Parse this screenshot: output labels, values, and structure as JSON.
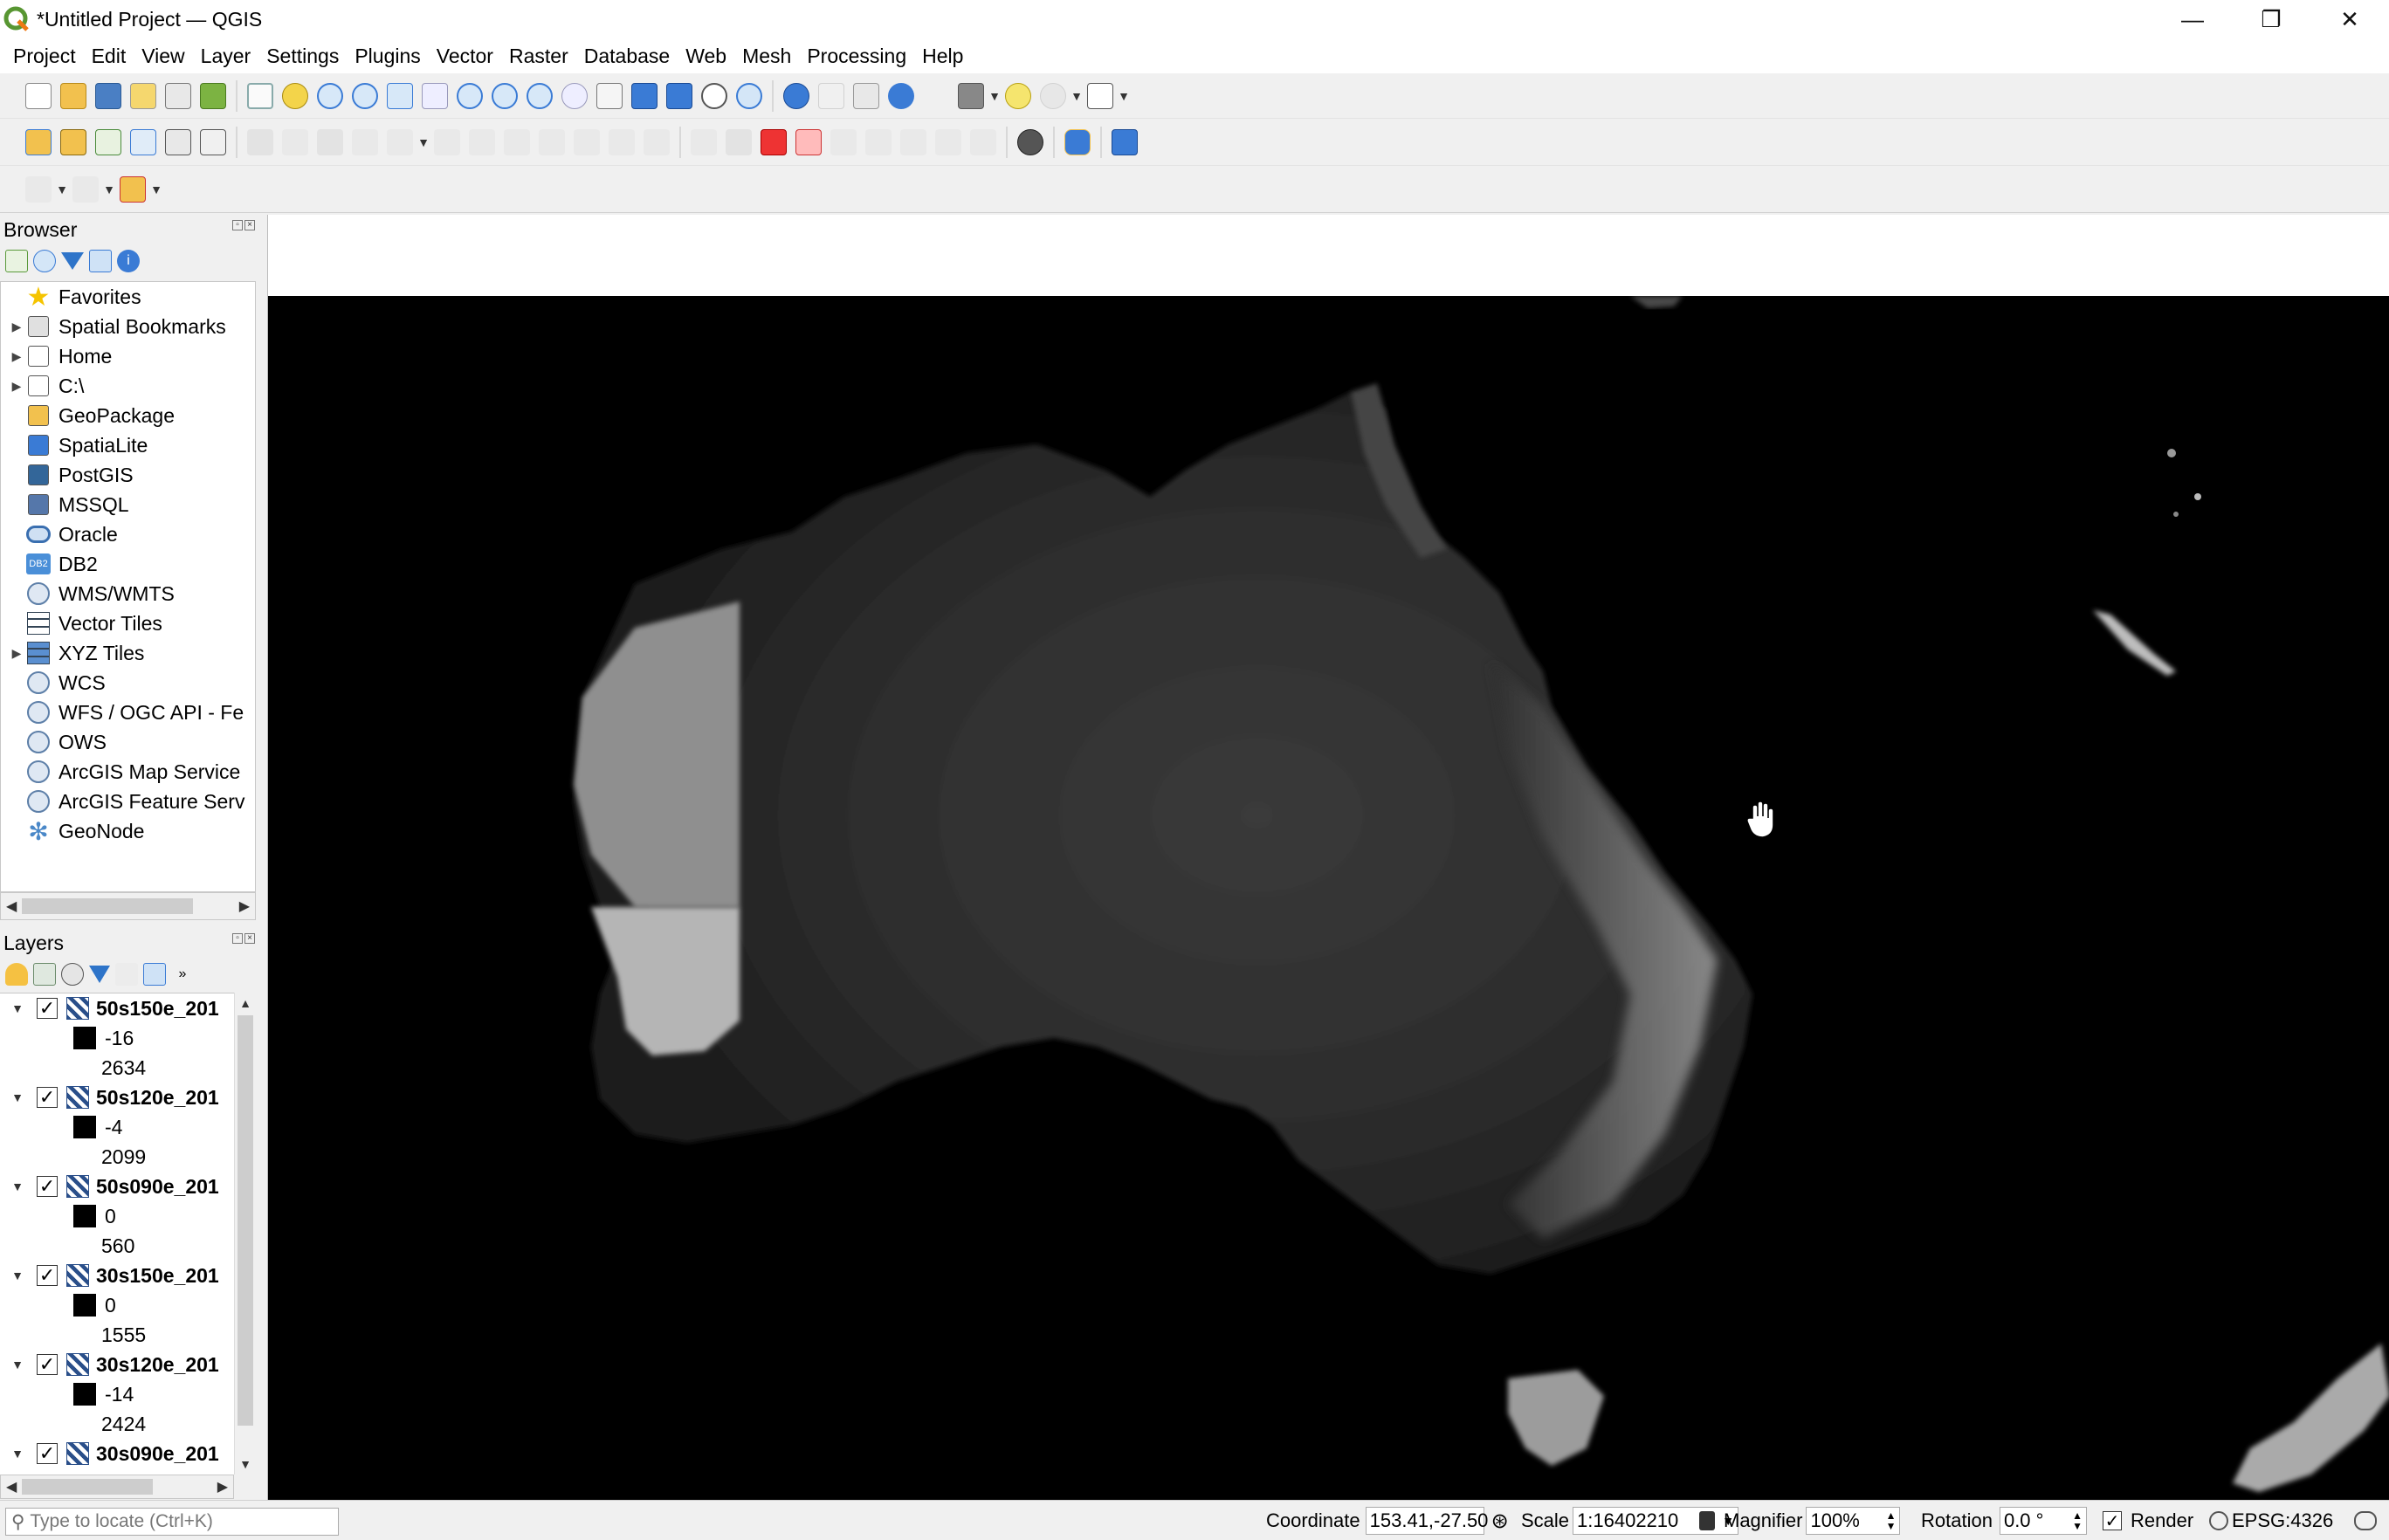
{
  "window": {
    "title": "*Untitled Project — QGIS",
    "minimize": "—",
    "restore": "❐",
    "close": "✕"
  },
  "menu": [
    {
      "label": "Project",
      "key": "P"
    },
    {
      "label": "Edit",
      "key": "E"
    },
    {
      "label": "View",
      "key": "V"
    },
    {
      "label": "Layer",
      "key": "L"
    },
    {
      "label": "Settings",
      "key": "S"
    },
    {
      "label": "Plugins",
      "key": "P"
    },
    {
      "label": "Vector",
      "key": "o"
    },
    {
      "label": "Raster",
      "key": "R"
    },
    {
      "label": "Database",
      "key": "D"
    },
    {
      "label": "Web",
      "key": "W"
    },
    {
      "label": "Mesh",
      "key": "M"
    },
    {
      "label": "Processing",
      "key": "c"
    },
    {
      "label": "Help",
      "key": "H"
    }
  ],
  "browser": {
    "title": "Browser",
    "items": [
      {
        "label": "Favorites",
        "icon": "star-icon",
        "expandable": false
      },
      {
        "label": "Spatial Bookmarks",
        "icon": "bookmark-icon",
        "expandable": true
      },
      {
        "label": "Home",
        "icon": "home-icon",
        "expandable": true
      },
      {
        "label": "C:\\",
        "icon": "drive-icon",
        "expandable": true
      },
      {
        "label": "GeoPackage",
        "icon": "geopackage-icon",
        "expandable": false
      },
      {
        "label": "SpatiaLite",
        "icon": "spatialite-icon",
        "expandable": false
      },
      {
        "label": "PostGIS",
        "icon": "postgis-icon",
        "expandable": false
      },
      {
        "label": "MSSQL",
        "icon": "mssql-icon",
        "expandable": false
      },
      {
        "label": "Oracle",
        "icon": "oracle-icon",
        "expandable": false
      },
      {
        "label": "DB2",
        "icon": "db2-icon",
        "expandable": false
      },
      {
        "label": "WMS/WMTS",
        "icon": "globe-icon",
        "expandable": false
      },
      {
        "label": "Vector Tiles",
        "icon": "grid-icon",
        "expandable": false
      },
      {
        "label": "XYZ Tiles",
        "icon": "xyz-grid-icon",
        "expandable": true
      },
      {
        "label": "WCS",
        "icon": "globe-icon",
        "expandable": false
      },
      {
        "label": "WFS / OGC API - Fe",
        "icon": "globe-icon",
        "expandable": false
      },
      {
        "label": "OWS",
        "icon": "globe-icon",
        "expandable": false
      },
      {
        "label": "ArcGIS Map Service",
        "icon": "arcgis-icon",
        "expandable": false
      },
      {
        "label": "ArcGIS Feature Serv",
        "icon": "arcgis-icon",
        "expandable": false
      },
      {
        "label": "GeoNode",
        "icon": "geonode-icon",
        "expandable": false
      }
    ]
  },
  "layers": {
    "title": "Layers",
    "items": [
      {
        "name": "50s150e_201",
        "min": "-16",
        "max": "2634",
        "checked": "✓"
      },
      {
        "name": "50s120e_201",
        "min": "-4",
        "max": "2099",
        "checked": "✓"
      },
      {
        "name": "50s090e_201",
        "min": "0",
        "max": "560",
        "checked": "✓"
      },
      {
        "name": "30s150e_201",
        "min": "0",
        "max": "1555",
        "checked": "✓"
      },
      {
        "name": "30s120e_201",
        "min": "-14",
        "max": "2424",
        "checked": "✓"
      },
      {
        "name": "30s090e_201",
        "min": "",
        "max": "",
        "checked": "✓"
      }
    ]
  },
  "status": {
    "locator_placeholder": "Type to locate (Ctrl+K)",
    "coordinate_label": "Coordinate",
    "coordinate_value": "153.41,-27.50",
    "scale_label": "Scale",
    "scale_value": "1:16402210",
    "magnifier_label": "Magnifier",
    "magnifier_value": "100%",
    "rotation_label": "Rotation",
    "rotation_value": "0.0 °",
    "render_label": "Render",
    "render_checked": "✓",
    "crs_label": "EPSG:4326"
  },
  "colors": {
    "accent": "#589632",
    "map_bg": "#000000"
  }
}
